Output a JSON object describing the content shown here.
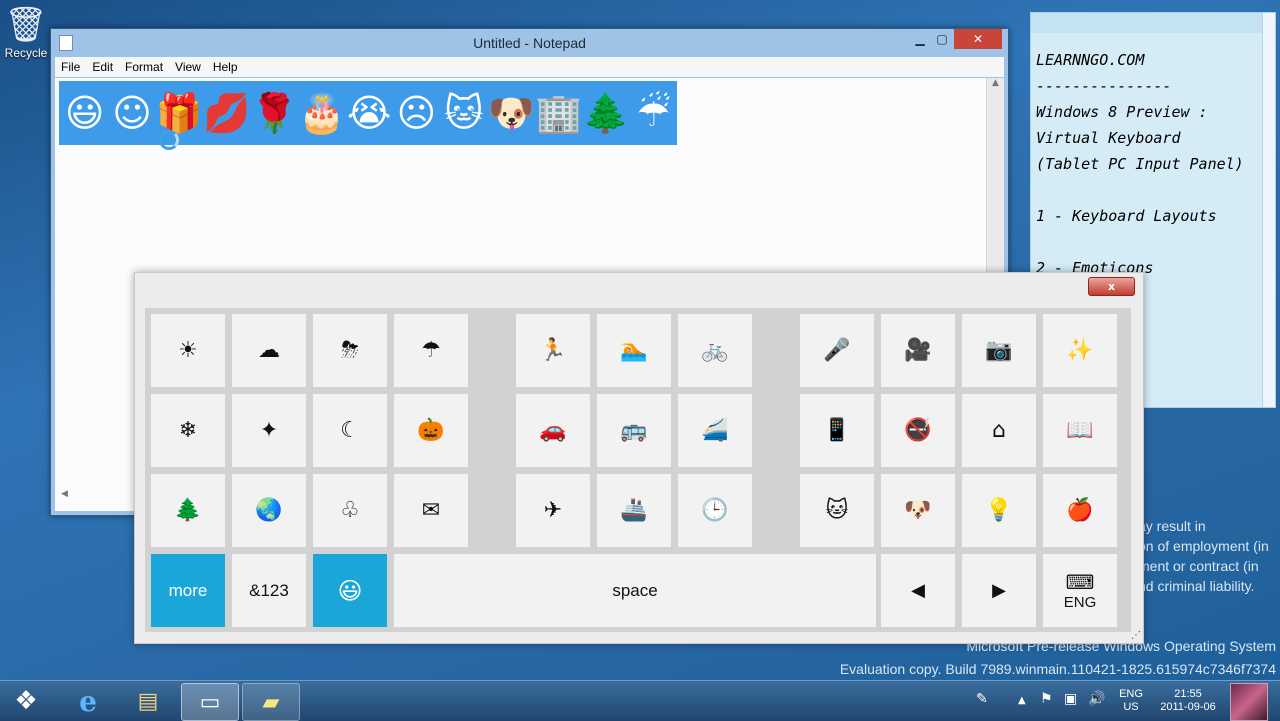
{
  "desktop": {
    "recycle_bin_label": "Recycle"
  },
  "notepad": {
    "title": "Untitled - Notepad",
    "menu": [
      "File",
      "Edit",
      "Format",
      "View",
      "Help"
    ],
    "typed_emoticons": [
      "😃",
      "☺",
      "🎁",
      "💋",
      "🌹",
      "🎂",
      "😭",
      "☹",
      "🐱",
      "🐶",
      "🏢",
      "🌲",
      "☔"
    ]
  },
  "sticky_note": {
    "lines": [
      "LEARNNGO.COM",
      "---------------",
      "Windows 8 Preview :",
      "Virtual Keyboard",
      "(Tablet PC Input Panel)",
      "",
      "1 - Keyboard Layouts",
      "",
      "2 - Emoticons"
    ]
  },
  "watermark": {
    "partial_line_1": "ay result in",
    "partial_line_2": "on of employment (in",
    "partial_line_3": "ment or contract (in",
    "partial_line_4": "nd criminal liability.",
    "os_line": "Microsoft Pre-release Windows Operating System",
    "build_line": "Evaluation copy. Build 7989.winmain.110421-1825.615974c7346f7374"
  },
  "keyboard": {
    "close_label": "x",
    "keys_row1_left": [
      "☀",
      "☁",
      "⛈",
      "☂"
    ],
    "keys_row1_mid": [
      "🏃",
      "🏊",
      "🚲"
    ],
    "keys_row1_right": [
      "🎤",
      "🎥",
      "📷",
      "✨"
    ],
    "keys_row2_left": [
      "❄",
      "✦",
      "☾",
      "🎃"
    ],
    "keys_row2_mid": [
      "🚗",
      "🚌",
      "🚄"
    ],
    "keys_row2_right": [
      "📱",
      "🚭",
      "⌂",
      "📖"
    ],
    "keys_row3_left": [
      "🌲",
      "🌏",
      "♧",
      "✉"
    ],
    "keys_row3_mid": [
      "✈",
      "🚢",
      "🕒"
    ],
    "keys_row3_right": [
      "🐱",
      "🐶",
      "💡",
      "🍎"
    ],
    "more_label": "more",
    "numbers_label": "&123",
    "emoji_toggle_glyph": "😃",
    "space_label": "space",
    "left_arrow": "◀",
    "right_arrow": "▶",
    "keyboard_glyph": "⌨",
    "lang_label": "ENG"
  },
  "taskbar": {
    "start_glyph": "❖",
    "ie_glyph": "e",
    "explorer_glyph": "▤",
    "notepad_glyph": "▭",
    "sticky_glyph": "▰",
    "lang_line1": "ENG",
    "lang_line2": "US",
    "time": "21:55",
    "date": "2011-09-06"
  },
  "colors": {
    "accent_key": "#1aa6d8",
    "emoticon_strip": "#3d9bea",
    "close_red": "#c43b30"
  }
}
